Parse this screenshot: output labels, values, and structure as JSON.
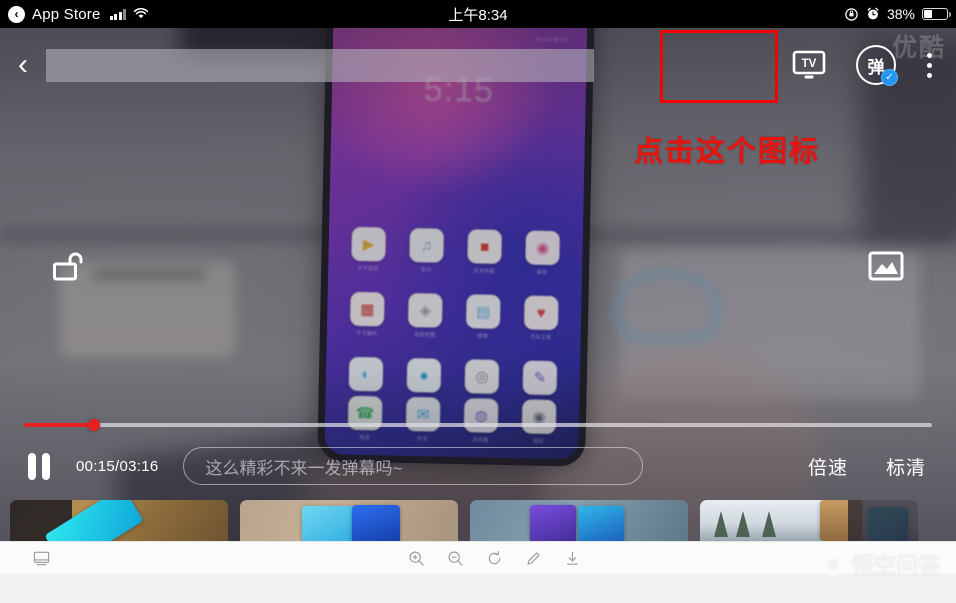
{
  "status_bar": {
    "back_app": "App Store",
    "back_icon": "back-chevron-icon",
    "signal_icon": "signal-bars-icon",
    "wifi_icon": "wifi-icon",
    "time": "上午8:34",
    "rotation_lock_icon": "rotation-lock-icon",
    "alarm_icon": "alarm-clock-icon",
    "battery_percent": "38%",
    "battery_level": 38
  },
  "player": {
    "back_icon": "back-chevron-icon",
    "title_redacted": "",
    "cast_icon": "tv-cast-icon",
    "cast_label": "TV",
    "danmaku_toggle_label": "弹",
    "danmaku_toggle_icon": "danmaku-toggle-icon",
    "danmaku_checked_icon": "check-badge-icon",
    "more_icon": "more-vertical-icon",
    "lock_icon": "unlock-icon",
    "screenshot_icon": "screenshot-icon",
    "play_state_icon": "pause-icon",
    "time_display": "00:15/03:16",
    "current_time": "00:15",
    "duration": "03:16",
    "progress_percent": 7.7,
    "danmaku_placeholder": "这么精彩不来一发弹幕吗~",
    "speed_label": "倍速",
    "quality_label": "标清",
    "watermark": "优酷"
  },
  "annotation": {
    "text": "点击这个图标",
    "box_color": "#f70000",
    "text_color": "#e8130f",
    "target_icon": "tv-cast-icon"
  },
  "mirrored_phone": {
    "lock_clock": "5:15",
    "carrier": "HUAWEI",
    "apps": [
      {
        "label": "千千音乐",
        "glyph": "▶",
        "bg": "#f4f2f6",
        "fg": "#e8b23a"
      },
      {
        "label": "音乐",
        "glyph": "♫",
        "bg": "#f2f4f8",
        "fg": "#8a9bb8"
      },
      {
        "label": "天天快报",
        "glyph": "■",
        "bg": "#f6f4f4",
        "fg": "#d93a2e"
      },
      {
        "label": "美拍",
        "glyph": "◉",
        "bg": "#f7f1f6",
        "fg": "#e04f93"
      },
      {
        "label": "千千静听",
        "glyph": "▦",
        "bg": "#f8f3f2",
        "fg": "#c8362f"
      },
      {
        "label": "百度地图",
        "glyph": "◈",
        "bg": "#f4f4f6",
        "fg": "#9aa3b2"
      },
      {
        "label": "相册",
        "glyph": "▤",
        "bg": "#f3f6fa",
        "fg": "#5fb6e8"
      },
      {
        "label": "汽车之家",
        "glyph": "♥",
        "bg": "#f8f2f4",
        "fg": "#e0404f"
      },
      {
        "label": "微信",
        "glyph": "◐",
        "bg": "#eef7fb",
        "fg": "#3fb7e8"
      },
      {
        "label": "手机管家",
        "glyph": "●",
        "bg": "#eef8fc",
        "fg": "#29a8dd"
      },
      {
        "label": "相机",
        "glyph": "◎",
        "bg": "#f3f4f6",
        "fg": "#7c8694"
      },
      {
        "label": "笔记",
        "glyph": "✎",
        "bg": "#f1f0f8",
        "fg": "#6b5fc0"
      }
    ],
    "dock": [
      {
        "label": "电话",
        "glyph": "☎",
        "bg": "#f0f7f2",
        "fg": "#3cba6a"
      },
      {
        "label": "信息",
        "glyph": "✉",
        "bg": "#eef6fb",
        "fg": "#3fa9e8"
      },
      {
        "label": "浏览器",
        "glyph": "◍",
        "bg": "#f3f1f7",
        "fg": "#7a6bc4"
      },
      {
        "label": "相机",
        "glyph": "◉",
        "bg": "#f2f3f5",
        "fg": "#6d7784"
      }
    ]
  },
  "related_thumbnails": [
    {
      "name": "thumbnail-1"
    },
    {
      "name": "thumbnail-2"
    },
    {
      "name": "thumbnail-3"
    },
    {
      "name": "thumbnail-4"
    }
  ],
  "desktop_toolbar": {
    "mirror_icon": "screen-mirror-icon",
    "zoom_in_icon": "zoom-in-icon",
    "zoom_out_icon": "zoom-out-icon",
    "rotate_icon": "rotate-icon",
    "edit_icon": "pencil-icon",
    "download_icon": "download-icon"
  },
  "watermark": {
    "logo_icon": "wukong-logo-icon",
    "text": "悟空问答"
  }
}
